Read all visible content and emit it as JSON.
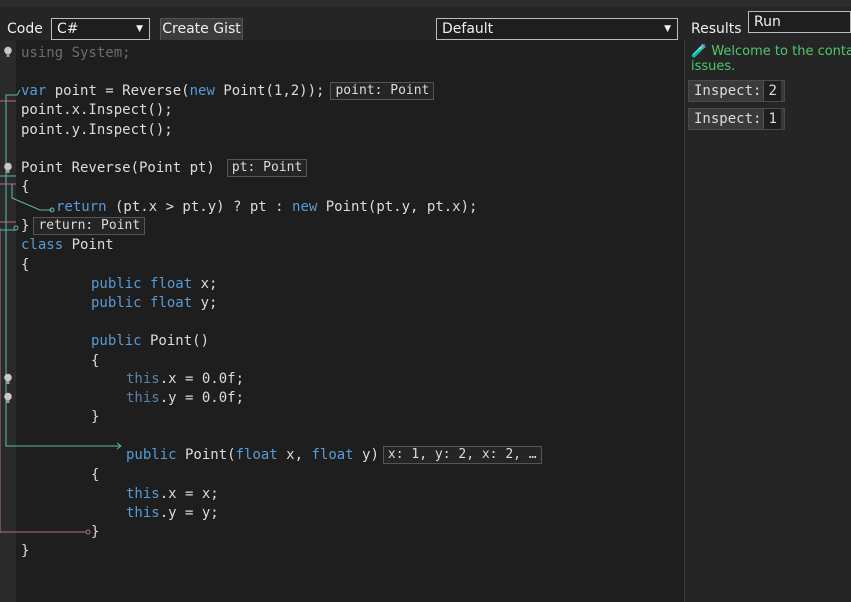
{
  "toolbar": {
    "code_label": "Code",
    "language": "C#",
    "create_gist": "Create Gist",
    "target": "Default",
    "results_label": "Results",
    "run": "Run"
  },
  "code": {
    "l1": "using System;",
    "l2a": "var",
    "l2b": " point = Reverse(",
    "l2c": "new",
    "l2d": " Point(1,2));",
    "l2hint": "point: Point",
    "l3": "point.x.Inspect();",
    "l4": "point.y.Inspect();",
    "l5": "Point Reverse(Point pt)",
    "l5hint": "pt: Point",
    "l6": "{",
    "l7a": "return",
    "l7b": " (pt.x > pt.y) ? pt : ",
    "l7c": "new",
    "l7d": " Point(pt.y, pt.x);",
    "l8": "}",
    "l8hint": "return: Point",
    "l9a": "class",
    "l9b": " Point",
    "l10": "{",
    "l11a": "public",
    "l11b": "float",
    "l11c": " x;",
    "l12a": "public",
    "l12b": "float",
    "l12c": " y;",
    "l13a": "public",
    "l13b": " Point()",
    "l14": "{",
    "l15a": "this",
    "l15b": ".x = 0.0f;",
    "l16a": "this",
    "l16b": ".y = 0.0f;",
    "l17": "}",
    "l18a": "public",
    "l18b": " Point(",
    "l18c": "float",
    "l18d": " x, ",
    "l18e": "float",
    "l18f": " y)",
    "l18hint": "x: 1, y: 2, x: 2, …",
    "l19": "{",
    "l20a": "this",
    "l20b": ".x = x;",
    "l21a": "this",
    "l21b": ".y = y;",
    "l22": "}",
    "l23": "}"
  },
  "results": {
    "welcome": "Welcome to the contair",
    "welcome2": "issues.",
    "inspect_label": "Inspect:",
    "inspect1": "2",
    "inspect2": "1"
  },
  "colors": {
    "keyword": "#569cd6",
    "comment": "#6d6d6d",
    "welcome": "#4ec96b",
    "flow_teal": "#5fb8a8",
    "flow_pink": "#b0708a"
  }
}
